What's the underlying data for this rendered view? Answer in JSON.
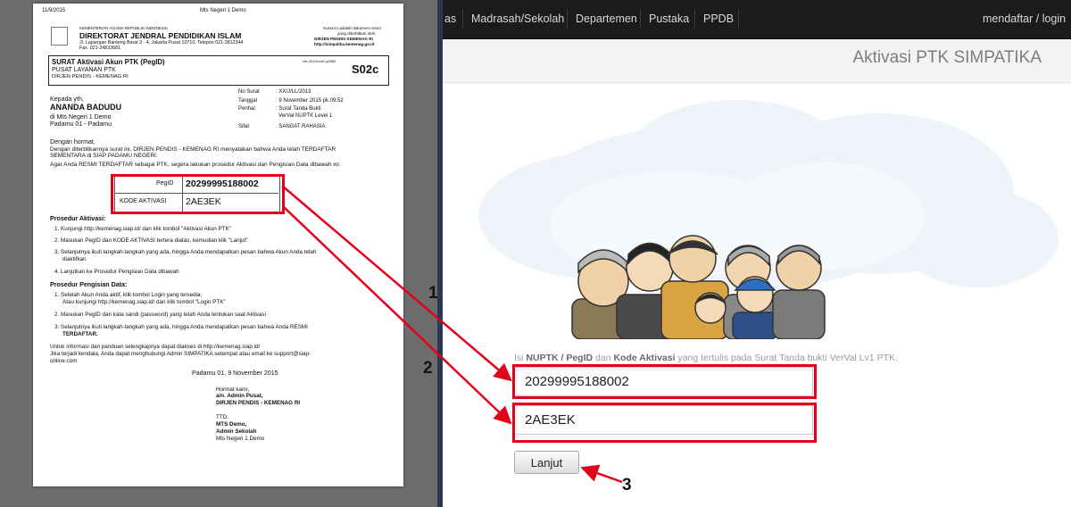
{
  "navbar": {
    "items": [
      "as",
      "Madrasah/Sekolah",
      "Departemen",
      "Pustaka",
      "PPDB"
    ],
    "right": "mendaftar / login"
  },
  "page_title": "Aktivasi PTK SIMPATIKA",
  "form": {
    "instruction_prefix": "Isi ",
    "instruction_b1": "NUPTK / PegID",
    "instruction_mid": " dan ",
    "instruction_b2": "Kode Aktivasi",
    "instruction_suffix": " yang tertulis pada Surat Tanda bukti VerVal Lv1 PTK.",
    "pegid_value": "20299995188002",
    "kode_value": "2AE3EK",
    "submit_label": "Lanjut"
  },
  "annotations": {
    "n1": "1",
    "n2": "2",
    "n3": "3"
  },
  "colors": {
    "annotation": "#e5001a",
    "navbar": "#1b1b1b"
  },
  "document": {
    "header_date": "11/9/2015",
    "header_center": "Mts Negeri 1 Demo",
    "ministry": "KEMENTERIAN AGAMA REPUBLIK INDONESIA",
    "directorate": "DIREKTORAT JENDRAL PENDIDIKAN ISLAM",
    "address": "Jl. Lapangan Banteng Barat 3 - 4, Jakarta Pusat 10710, Telepon 021-3812344",
    "fax": "Fax. 021-34833681",
    "validity_1": "Surat ini adalah dokumen resmi",
    "validity_2": "yang diterbitkan oleh",
    "validity_3": "DIRJEN PENDIS KEMENAG RI",
    "validity_4": "http://simpatika.kemenag.go.id",
    "surat_title": "SURAT Aktivasi Akun PTK (PegID)",
    "pusat": "PUSAT LAYANAN PTK",
    "dirjen": "DIRJEN PENDIS - KEMENAG RI",
    "version": "ver.2013/ccb2.p0580",
    "code": "S02c",
    "kepada": "Kepada yth,",
    "name": "ANANDA BADUDU",
    "di": "di Mts Negeri 1 Demo",
    "city": "Padamu 01 - Padamu",
    "no_surat_label": "No Surat",
    "no_surat": ": XX/J/LL/2013",
    "tanggal_label": "Tanggal",
    "tanggal": ": 9 November 2015 pk.09:52",
    "perihal_label": "Perihal",
    "perihal_1": ": Surat Tanda Bukti",
    "perihal_2": "VerVal NUPTK Level 1",
    "sifat_label": "Sifat",
    "sifat": ": SANGAT RAHASIA",
    "greeting": "Dengan hormat,",
    "body_1": "Dengan diterbitkannya surat ini, DIRJEN PENDIS - KEMENAG RI menyatakan bahwa Anda telah TERDAFTAR",
    "body_2": "SEMENTARA di SIAP PADAMU NEGERI.",
    "body_3": "Agar Anda RESMI TERDAFTAR sebagai PTK, segera lakukan prosedur Aktivasi dan Pengisian Data dibawah ini.",
    "pegid_label": "PegID",
    "pegid_value": "20299995188002",
    "kode_label": "KODE AKTIVASI",
    "kode_value": "2AE3EK",
    "prosedur_aktivasi": "Prosedur Aktivasi:",
    "akt_1": "1.  Kunjungi http://kemenag.siap.id/ dan klik tombol \"Aktivasi Akun PTK\"",
    "akt_2": "2.  Masukan PegID dan KODE AKTIVASI tertera diatas, kemudian klik \"Lanjut\"",
    "akt_3a": "3.  Selanjutnya ikuti langkah-langkah yang ada, hingga Anda mendapatkan pesan bahwa Akun Anda telah",
    "akt_3b": "diaktifkan",
    "akt_4": "4.  Lanjutkan ke Prosedur Pengisian Data dibawah",
    "prosedur_pengisian": "Prosedur Pengisian Data:",
    "peng_1a": "1.  Setelah Akun Anda aktif, klik tombol Login yang tersedia;",
    "peng_1b": "Atau kunjungi http://kemenag.siap.id/ dan klik tombol \"Login PTK\"",
    "peng_2": "2.  Masukan PegID dan kata sandi (password) yang telah Anda tentukan saat Aktivasi",
    "peng_3a": "3.  Selanjutnya ikuti langkah-langkah yang ada, hingga Anda mendapatkan pesan bahwa Anda RESMI",
    "peng_3b": "TERDAFTAR.",
    "info_1": "Untuk informasi dan panduan selengkapnya dapat diakses di http://kemenag.siap.id/",
    "info_2": "Jika terjadi kendala, Anda dapat menghubungi Admin SIMPATIKA setempat atau email ke support@siap-",
    "info_3": "online.com",
    "place_date": "Padamu 01, 9 November 2015",
    "hormat": "Hormat kami,",
    "an": "a/n. Admin Pusat,",
    "dirjen_sign": "DIRJEN PENDIS - KEMENAG RI",
    "ttd": "TTD.",
    "mts_demo": "MTS Demo,",
    "admin_sekolah": "Admin Sekolah",
    "mts_negeri": "Mts Negeri 1 Demo"
  }
}
